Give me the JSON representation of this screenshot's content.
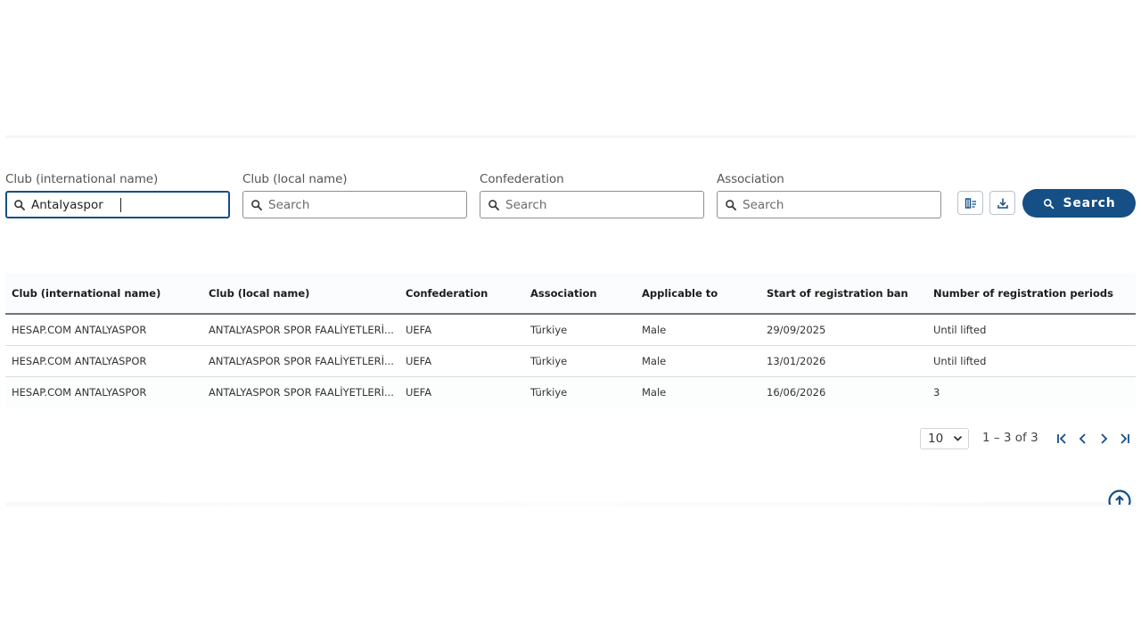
{
  "filters": [
    {
      "label": "Club (international name)",
      "value": "Antalyaspor",
      "placeholder": "Search"
    },
    {
      "label": "Club (local name)",
      "value": "",
      "placeholder": "Search"
    },
    {
      "label": "Confederation",
      "value": "",
      "placeholder": "Search"
    },
    {
      "label": "Association",
      "value": "",
      "placeholder": "Search"
    }
  ],
  "toolbar": {
    "columns_icon": "column-settings-icon",
    "download_icon": "download-icon",
    "search_label": "Search"
  },
  "table": {
    "headers": [
      "Club (international name)",
      "Club (local name)",
      "Confederation",
      "Association",
      "Applicable to",
      "Start of registration ban",
      "Number of registration periods"
    ],
    "rows": [
      [
        "HESAP.COM ANTALYASPOR",
        "ANTALYASPOR SPOR FAALİYETLERİ...",
        "UEFA",
        "Türkiye",
        "Male",
        "29/09/2025",
        "Until lifted"
      ],
      [
        "HESAP.COM ANTALYASPOR",
        "ANTALYASPOR SPOR FAALİYETLERİ...",
        "UEFA",
        "Türkiye",
        "Male",
        "13/01/2026",
        "Until lifted"
      ],
      [
        "HESAP.COM ANTALYASPOR",
        "ANTALYASPOR SPOR FAALİYETLERİ...",
        "UEFA",
        "Türkiye",
        "Male",
        "16/06/2026",
        "3"
      ]
    ]
  },
  "pagination": {
    "page_size": "10",
    "range": "1 – 3 of 3"
  },
  "colors": {
    "primary": "#154f86"
  }
}
